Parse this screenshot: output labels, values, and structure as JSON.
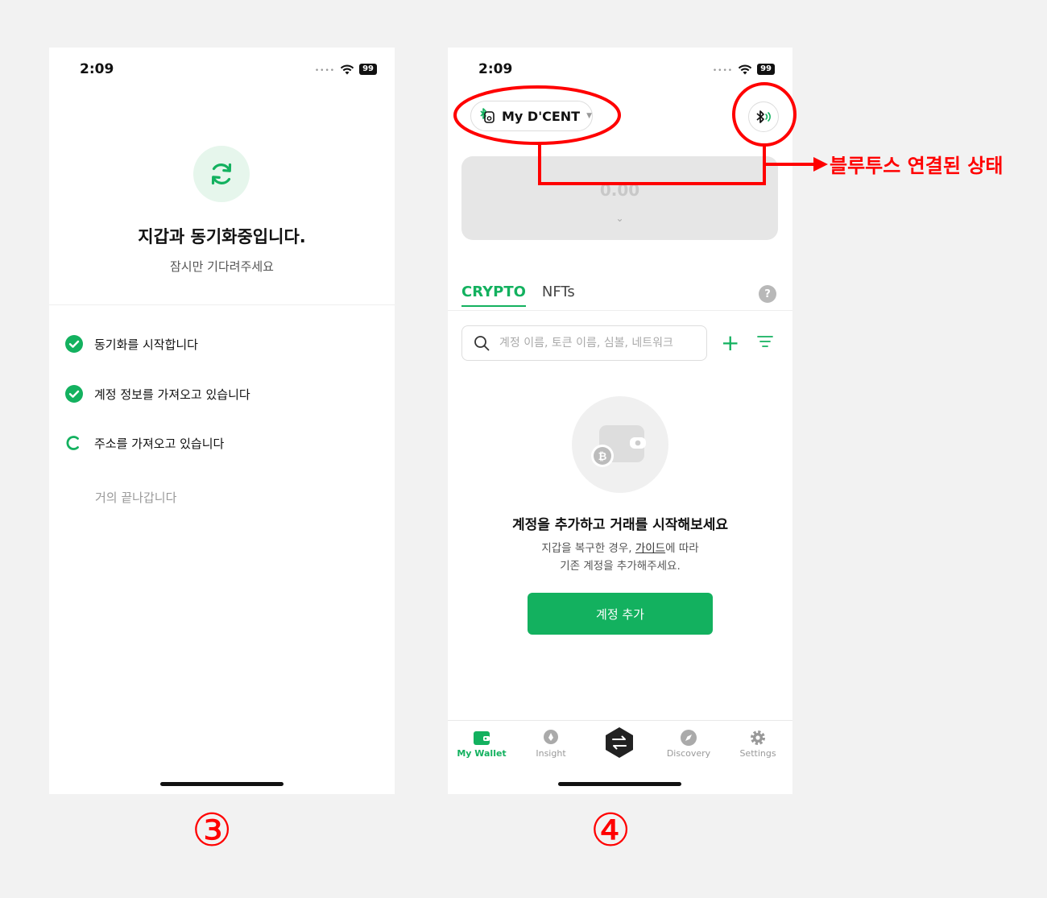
{
  "screen3": {
    "status": {
      "time": "2:09",
      "battery": "99"
    },
    "title": "지갑과 동기화중입니다.",
    "subtitle": "잠시만 기다려주세요",
    "steps": [
      {
        "label": "동기화를 시작합니다",
        "state": "done"
      },
      {
        "label": "계정 정보를 가져오고 있습니다",
        "state": "done"
      },
      {
        "label": "주소를 가져오고 있습니다",
        "state": "loading"
      },
      {
        "label": "거의 끝나갑니다",
        "state": "pending"
      }
    ]
  },
  "screen4": {
    "status": {
      "time": "2:09",
      "battery": "99"
    },
    "device_name": "My D'CENT",
    "balance": "0.00",
    "tabs": {
      "crypto": "CRYPTO",
      "nfts": "NFTs"
    },
    "search": {
      "placeholder": "계정 이름, 토큰 이름, 심볼, 네트워크"
    },
    "empty": {
      "title": "계정을 추가하고 거래를 시작해보세요",
      "desc_line1_prefix": "지갑을 복구한 경우, ",
      "desc_guide_link": "가이드",
      "desc_line1_suffix": "에 따라",
      "desc_line2": "기존 계정을 추가해주세요."
    },
    "add_account_label": "계정 추가",
    "nav": {
      "my_wallet": "My Wallet",
      "insight": "Insight",
      "discovery": "Discovery",
      "settings": "Settings"
    }
  },
  "annotations": {
    "bluetooth_label": "블루투스 연결된 상태",
    "step3": "③",
    "step4": "④",
    "color": "#ff0000"
  },
  "colors": {
    "accent": "#13b15f"
  }
}
